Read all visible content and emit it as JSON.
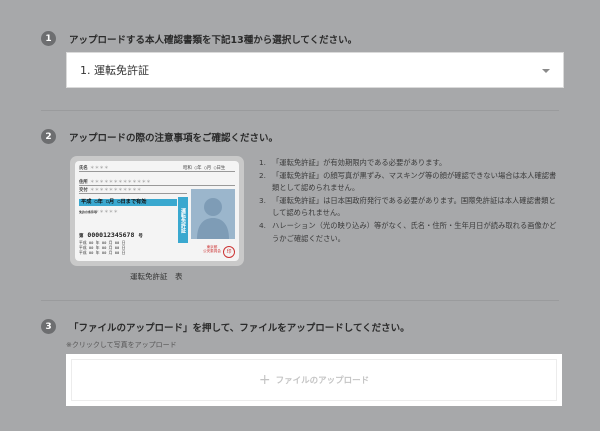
{
  "steps": [
    {
      "num": "1",
      "title": "アップロードする本人確認書類を下記13種から選択してください。"
    },
    {
      "num": "2",
      "title": "アップロードの際の注意事項をご確認ください。"
    },
    {
      "num": "3",
      "title": "「ファイルのアップロード」を押して、ファイルをアップロードしてください。"
    }
  ],
  "document_select": {
    "value": "1. 運転免許証"
  },
  "card": {
    "name_label": "氏名",
    "name_mask": "＊＊＊＊",
    "birth_label": "昭和",
    "birth_text": "○年 ○月 ○日生",
    "address_label": "住所",
    "address_mask": "＊＊＊＊＊＊＊＊＊＊＊＊＊",
    "issue_label": "交付",
    "issue_mask": "＊＊＊＊＊＊＊＊＊＊＊",
    "valid_text": "平成 ○年 ○月 ○日まで有効",
    "cond_label": "免許の条件等",
    "cond_mask": "＊＊＊＊＊＊",
    "vertical_label": "運転免許証",
    "number_prefix": "第",
    "number": "000012345678",
    "number_suffix": "号",
    "dates": [
      "平成 00 年 00 月 00 日",
      "平成 00 年 00 月 00 日",
      "平成 00 年 00 月 00 日"
    ],
    "issuer": "東京都\n公安委員会",
    "stamp": "印"
  },
  "card_caption": "運転免許証　表",
  "notes": [
    {
      "n": "1.",
      "text": "「運転免許証」が有効期限内である必要があります。"
    },
    {
      "n": "2.",
      "text": "「運転免許証」の顔写真が黒ずみ、マスキング等の顔が確認できない場合は本人確認書類として認められません。"
    },
    {
      "n": "3.",
      "text": "「運転免許証」は日本国政府発行である必要があります。国際免許証は本人確認書類として認められません。"
    },
    {
      "n": "4.",
      "text": "ハレーション（光の映り込み）等がなく、氏名・住所・生年月日が読み取れる画像かどうかご確認ください。"
    }
  ],
  "upload": {
    "hint": "※クリックして写真をアップロード",
    "plus": "+",
    "label": "ファイルのアップロード"
  }
}
